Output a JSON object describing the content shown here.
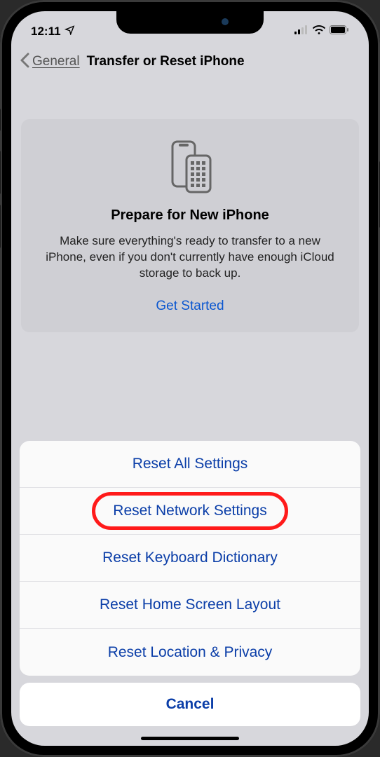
{
  "status": {
    "time": "12:11"
  },
  "nav": {
    "back_label": "General",
    "title": "Transfer or Reset iPhone"
  },
  "card": {
    "title": "Prepare for New iPhone",
    "description": "Make sure everything's ready to transfer to a new iPhone, even if you don't currently have enough iCloud storage to back up.",
    "action": "Get Started"
  },
  "actions": {
    "items": [
      "Reset All Settings",
      "Reset Network Settings",
      "Reset Keyboard Dictionary",
      "Reset Home Screen Layout",
      "Reset Location & Privacy"
    ],
    "cancel": "Cancel",
    "highlighted_index": 1
  }
}
